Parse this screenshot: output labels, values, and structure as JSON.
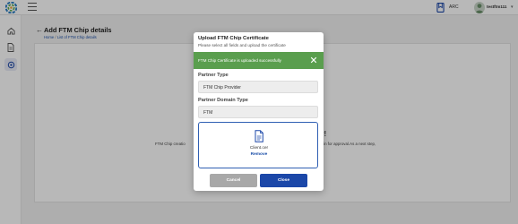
{
  "header": {
    "language": "ARC",
    "username": "testftm111"
  },
  "page": {
    "title": "Add FTM Chip details",
    "breadcrumb": {
      "home": "Home",
      "separator": "/",
      "current": "List of FTM Chip details"
    },
    "background_heading_fragment": "y!",
    "background_text_left": "FTM Chip creatio",
    "background_text_right": "dmin for approval.As a next step,"
  },
  "modal": {
    "title": "Upload FTM Chip Certificate",
    "subtitle": "Please select all fields and upload the certificate",
    "alert": {
      "message": "FTM Chip Certificate is uploaded successfully",
      "color": "#5a9e4e"
    },
    "partner_type": {
      "label": "Partner Type",
      "value": "FTM Chip Provider"
    },
    "partner_domain_type": {
      "label": "Partner Domain Type",
      "value": "FTM"
    },
    "upload": {
      "file_name": "Client.cer",
      "remove_label": "Remove"
    },
    "buttons": {
      "cancel": "Cancel",
      "close": "Close"
    }
  },
  "colors": {
    "primary": "#1b47a8",
    "success": "#5a9e4e",
    "disabled": "#a8a8a8"
  }
}
